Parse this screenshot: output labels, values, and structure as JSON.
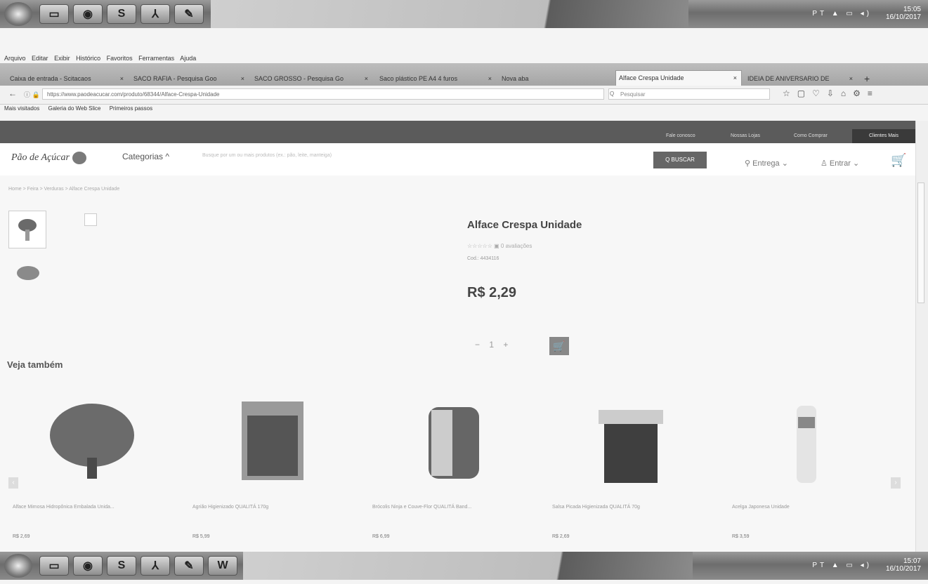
{
  "taskbar_top": {
    "apps": [
      "windows-start",
      "file-explorer",
      "chrome",
      "skype",
      "adobe-reader",
      "paint"
    ],
    "tray_text": "PT",
    "time": "15:05",
    "date": "16/10/2017"
  },
  "taskbar_bottom": {
    "apps": [
      "windows-start",
      "file-explorer",
      "chrome",
      "skype",
      "adobe-reader",
      "paint",
      "word"
    ],
    "tray_text": "PT",
    "time": "15:07",
    "date": "16/10/2017"
  },
  "browser": {
    "menu": [
      "Arquivo",
      "Editar",
      "Exibir",
      "Histórico",
      "Favoritos",
      "Ferramentas",
      "Ajuda"
    ],
    "tabs": [
      {
        "label": "Caixa de entrada - Scitacaos",
        "active": false
      },
      {
        "label": "SACO RAFIA - Pesquisa Goo",
        "active": false
      },
      {
        "label": "SACO GROSSO - Pesquisa Go",
        "active": false
      },
      {
        "label": "Saco plástico PE A4 4 furos",
        "active": false
      },
      {
        "label": "Nova aba",
        "active": false
      },
      {
        "label": "Alface Crespa Unidade",
        "active": true
      },
      {
        "label": "IDEIA DE ANIVERSARIO DE",
        "active": false
      }
    ],
    "new_tab": "+",
    "url": "https://www.paodeacucar.com/produto/68344/Alface-Crespa-Unidade",
    "search_placeholder": "Pesquisar",
    "bookmarks": [
      "Mais visitados",
      "Galeria do Web Slice",
      "Primeiros passos"
    ]
  },
  "site": {
    "top_links": [
      "Fale conosco",
      "Nossas Lojas",
      "Como Comprar"
    ],
    "account_label": "Clientes Mais",
    "logo": "Pão de Açúcar",
    "categories_label": "Categorias",
    "search_placeholder": "Busque por um ou mais produtos (ex.: pão, leite, manteiga)",
    "search_button": "BUSCAR",
    "delivery_label": "Entrega",
    "login_label": "Entrar"
  },
  "breadcrumb": [
    "Home",
    "Feira",
    "Verduras",
    "Alface Crespa Unidade"
  ],
  "product": {
    "title": "Alface Crespa Unidade",
    "rating_text": "0 avaliações",
    "code": "Cod.: 4434116",
    "price": "R$ 2,29",
    "quantity": "1",
    "minus": "−",
    "plus": "+"
  },
  "related_title": "Veja também",
  "related": [
    {
      "name": "Alface Mimosa Hidropônica Embalada Unida...",
      "price": "R$ 2,69"
    },
    {
      "name": "Agrião Higienizado QUALITÁ 170g",
      "price": "R$ 5,99"
    },
    {
      "name": "Brócolis Ninja e Couve-Flor QUALITÁ Band...",
      "price": "R$ 6,99"
    },
    {
      "name": "Salsa Picada Higienizada QUALITÁ 70g",
      "price": "R$ 2,69"
    },
    {
      "name": "Acelga Japonesa Unidade",
      "price": "R$ 3,59"
    }
  ]
}
